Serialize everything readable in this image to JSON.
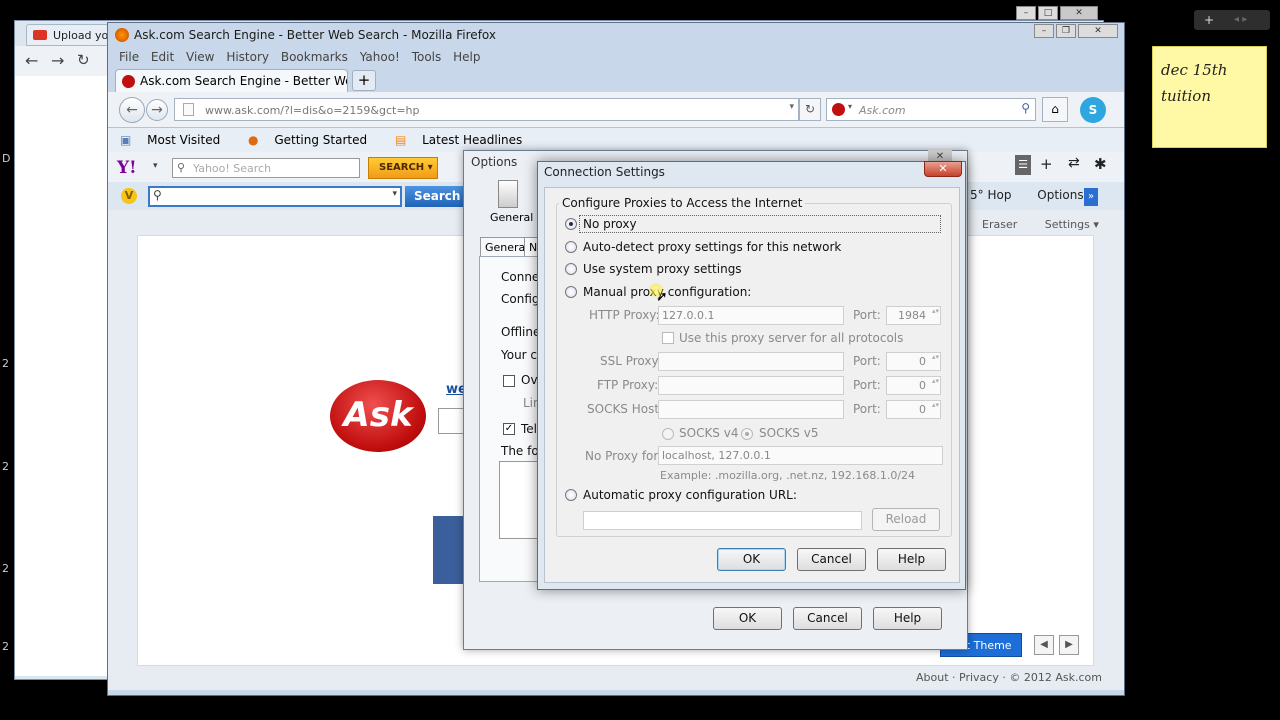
{
  "background_window": {
    "tab_label": "Upload you"
  },
  "main_window": {
    "title": "Ask.com Search Engine - Better Web Search - Mozilla Firefox",
    "menu": [
      "File",
      "Edit",
      "View",
      "History",
      "Bookmarks",
      "Yahoo!",
      "Tools",
      "Help"
    ],
    "tab_label": "Ask.com Search Engine - Better Web Sea...",
    "new_tab": "+",
    "url": "www.ask.com/?l=dis&o=2159&gct=hp",
    "search_placeholder": "Ask.com",
    "bookmarks": [
      "Most Visited",
      "Getting Started",
      "Latest Headlines"
    ],
    "yahoo_logo": "Y!",
    "yahoo_search_placeholder": "Yahoo! Search",
    "yahoo_search_button": "SEARCH",
    "ask_search_button": "Search",
    "right_toolbar": [
      "5° Hop",
      "Options"
    ],
    "right_links": [
      "Eraser",
      "Settings"
    ],
    "page": {
      "logo": "Ask",
      "link_fragment": "we",
      "select_theme": "ect Theme",
      "footer": "About · Privacy · © 2012 Ask.com"
    }
  },
  "options_dialog": {
    "title": "Options",
    "general_label": "General",
    "tabs": [
      "General",
      "N"
    ],
    "fragments": [
      "Connec",
      "Config",
      "Offline",
      "Your ca",
      "Ov",
      "Lin",
      "Tel",
      "The fol"
    ],
    "buttons": {
      "ok": "OK",
      "cancel": "Cancel",
      "help": "Help"
    }
  },
  "connection_settings": {
    "title": "Connection Settings",
    "group_label": "Configure Proxies to Access the Internet",
    "options": {
      "no_proxy": "No proxy",
      "auto_detect": "Auto-detect proxy settings for this network",
      "system": "Use system proxy settings",
      "manual": "Manual proxy configuration:",
      "auto_url": "Automatic proxy configuration URL:"
    },
    "selected": "no_proxy",
    "manual": {
      "http_label": "HTTP Proxy:",
      "http_value": "127.0.0.1",
      "http_port": "1984",
      "port_label": "Port:",
      "same_proxy_label": "Use this proxy server for all protocols",
      "ssl_label": "SSL Proxy:",
      "ssl_port": "0",
      "ftp_label": "FTP Proxy:",
      "ftp_port": "0",
      "socks_label": "SOCKS Host:",
      "socks_port": "0",
      "socks_v4": "SOCKS v4",
      "socks_v5": "SOCKS v5",
      "no_proxy_label": "No Proxy for:",
      "no_proxy_value": "localhost, 127.0.0.1",
      "example": "Example: .mozilla.org, .net.nz, 192.168.1.0/24"
    },
    "reload": "Reload",
    "buttons": {
      "ok": "OK",
      "cancel": "Cancel",
      "help": "Help"
    }
  },
  "sticky_note": {
    "line1": "dec 15th",
    "line2": "tuition"
  },
  "colors": {
    "ask_red": "#c10e0e",
    "close_red": "#c7412b",
    "firefox_chrome": "#c8d8ea"
  }
}
